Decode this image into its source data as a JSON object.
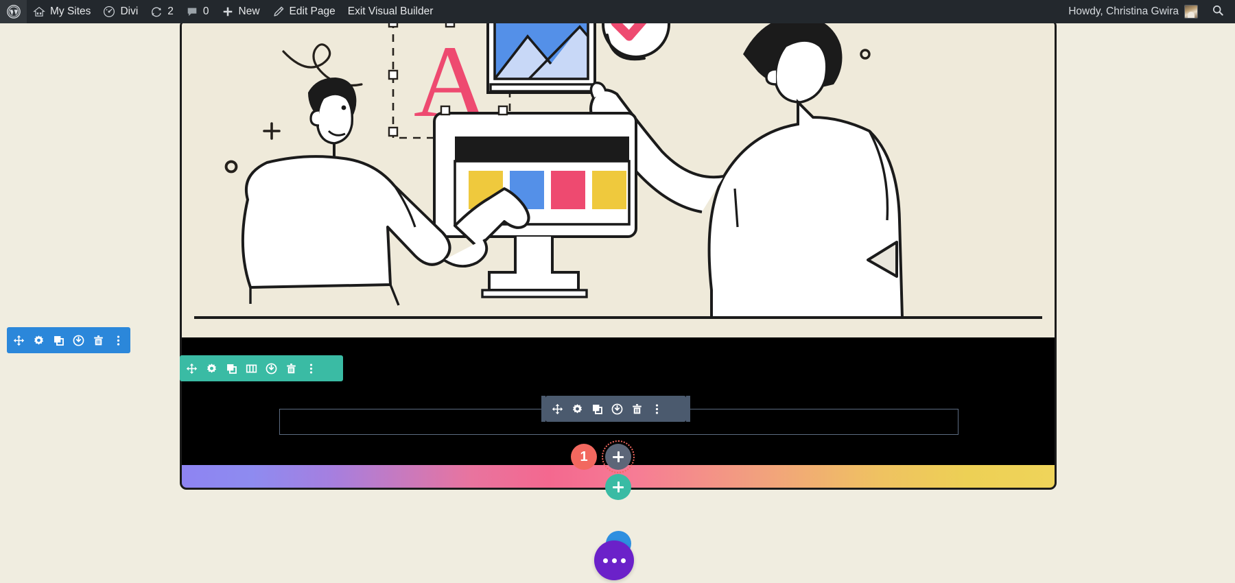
{
  "admin_bar": {
    "logo_icon": "wordpress-logo-icon",
    "items": [
      {
        "icon": "sites-house-icon",
        "label": "My Sites",
        "name": "admin-bar-my-sites"
      },
      {
        "icon": "divi-speedometer-icon",
        "label": "Divi",
        "name": "admin-bar-divi"
      },
      {
        "icon": "revisions-icon",
        "label": "2",
        "name": "admin-bar-updates"
      },
      {
        "icon": "comment-bubble-icon",
        "label": "0",
        "name": "admin-bar-comments"
      },
      {
        "icon": "plus-icon",
        "label": "New",
        "name": "admin-bar-new"
      },
      {
        "icon": "pencil-icon",
        "label": "Edit Page",
        "name": "admin-bar-edit-page"
      },
      {
        "icon": "",
        "label": "Exit Visual Builder",
        "name": "admin-bar-exit-visual-builder"
      }
    ],
    "howdy": "Howdy, Christina Gwira",
    "avatar_name": "user-avatar",
    "search_icon": "search-icon",
    "background": "#23282D"
  },
  "builder": {
    "row_toolbar": {
      "color": "#2B87DA",
      "buttons": [
        {
          "icon": "move-icon",
          "name": "row-move-button",
          "title": "Move Row"
        },
        {
          "icon": "gear-icon",
          "name": "row-settings-button",
          "title": "Row Settings"
        },
        {
          "icon": "duplicate-icon",
          "name": "row-duplicate-button",
          "title": "Duplicate Row"
        },
        {
          "icon": "power-icon",
          "name": "row-disable-button",
          "title": "Disable Row"
        },
        {
          "icon": "trash-icon",
          "name": "row-delete-button",
          "title": "Delete Row"
        },
        {
          "icon": "more-dots-icon",
          "name": "row-more-button",
          "title": "More Options"
        }
      ]
    },
    "section_toolbar": {
      "color": "#3ABBA4",
      "buttons": [
        {
          "icon": "move-icon",
          "name": "section-move-button",
          "title": "Move Section"
        },
        {
          "icon": "gear-icon",
          "name": "section-settings-button",
          "title": "Section Settings"
        },
        {
          "icon": "duplicate-icon",
          "name": "section-duplicate-button",
          "title": "Duplicate Section"
        },
        {
          "icon": "columns-icon",
          "name": "section-columns-button",
          "title": "Change Column Structure"
        },
        {
          "icon": "power-icon",
          "name": "section-disable-button",
          "title": "Disable Section"
        },
        {
          "icon": "trash-icon",
          "name": "section-delete-button",
          "title": "Delete Section"
        },
        {
          "icon": "more-dots-icon",
          "name": "section-more-button",
          "title": "More Options"
        }
      ]
    },
    "module_toolbar": {
      "color": "#4B5A6E",
      "buttons": [
        {
          "icon": "move-icon",
          "name": "module-move-button",
          "title": "Move Module"
        },
        {
          "icon": "gear-icon",
          "name": "module-settings-button",
          "title": "Module Settings"
        },
        {
          "icon": "duplicate-icon",
          "name": "module-duplicate-button",
          "title": "Duplicate Module"
        },
        {
          "icon": "power-icon",
          "name": "module-disable-button",
          "title": "Disable Module"
        },
        {
          "icon": "trash-icon",
          "name": "module-delete-button",
          "title": "Delete Module"
        },
        {
          "icon": "more-dots-icon",
          "name": "module-more-button",
          "title": "More Options"
        }
      ]
    },
    "count_badge": {
      "label": "1",
      "color": "#F2685F"
    },
    "add_module_button": {
      "icon": "plus-icon",
      "color": "#5C6678",
      "outline_color": "#F2685F"
    },
    "add_row_button": {
      "icon": "plus-icon",
      "color": "#3ABBA4"
    },
    "module_outline": {
      "border_color": "#5C6C82",
      "value": "",
      "placeholder": ""
    },
    "floating_button": {
      "name": "divi-floating-menu-button",
      "icon": "three-dots-icon",
      "main_color": "#6B21C9",
      "accent_color": "#2E8FE0"
    }
  },
  "content": {
    "section_background": "#000000",
    "illustration_background": "#EFEADA",
    "illustration_name": "team-designing-website-illustration",
    "gradient_strip": {
      "name": "gradient-divider",
      "from": "#8E84F2",
      "mid": "#F4688F",
      "to": "#EFD45A"
    },
    "palette": {
      "yellow": "#EFC93D",
      "blue": "#5490E8",
      "pink": "#EE4A70",
      "light_blue": "#C8D8F7",
      "ink": "#1B1B1B"
    },
    "illustration_elements": [
      "letter-A-glyph",
      "image-frame-mountains",
      "checkmark-circle",
      "monitor-with-color-blocks",
      "seated-person",
      "standing-person",
      "play-triangle",
      "swirl-doodle",
      "small-circle",
      "small-plus"
    ]
  }
}
